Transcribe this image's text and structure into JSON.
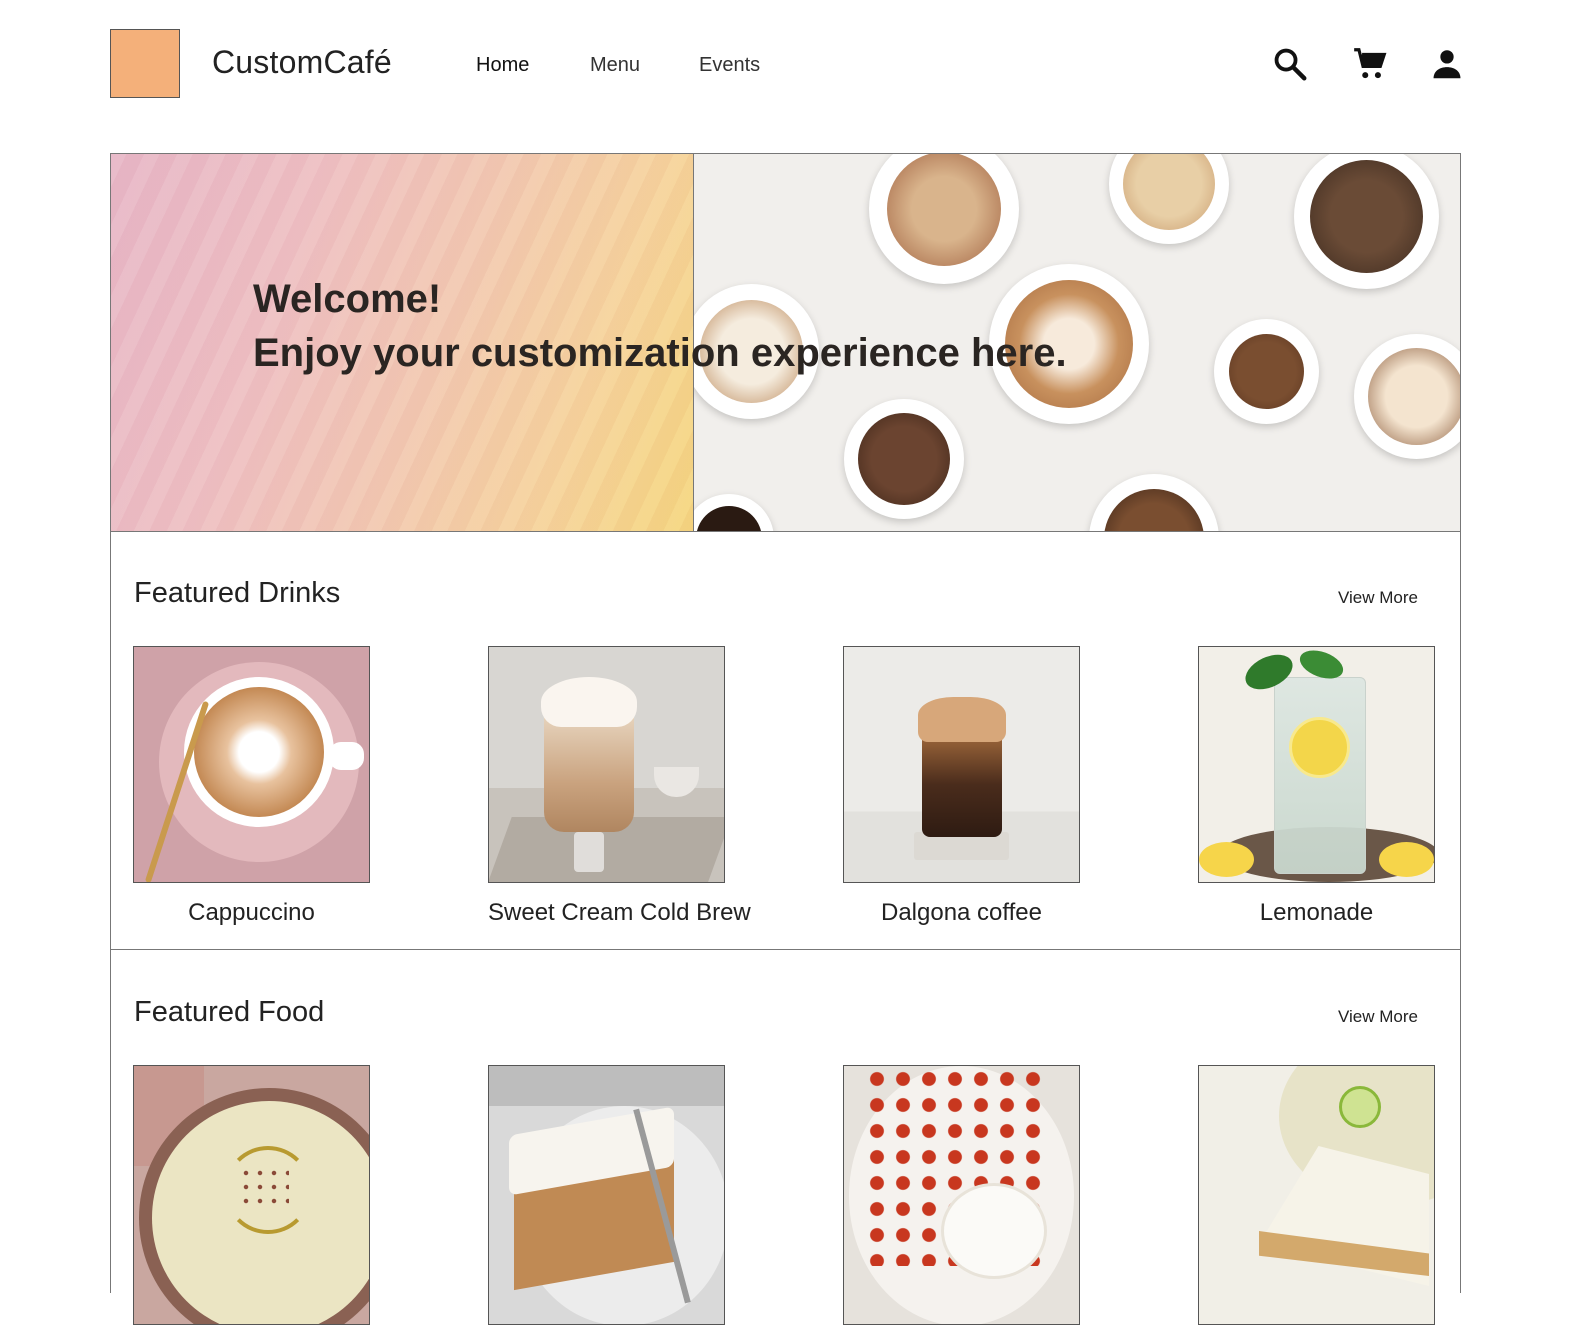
{
  "header": {
    "brand": "CustomCafé",
    "nav": [
      "Home",
      "Menu",
      "Events"
    ],
    "icons": [
      "search-icon",
      "cart-icon",
      "account-icon"
    ]
  },
  "hero": {
    "line1": "Welcome!",
    "line2": "Enjoy your customization experience here."
  },
  "featured_drinks": {
    "title": "Featured Drinks",
    "view_more": "View More",
    "items": [
      {
        "label": "Cappuccino"
      },
      {
        "label": "Sweet Cream Cold Brew"
      },
      {
        "label": "Dalgona coffee"
      },
      {
        "label": "Lemonade"
      }
    ]
  },
  "featured_food": {
    "title": "Featured Food",
    "view_more": "View More"
  },
  "colors": {
    "logo": "#f4b07a",
    "border": "#777777",
    "text": "#222222"
  }
}
